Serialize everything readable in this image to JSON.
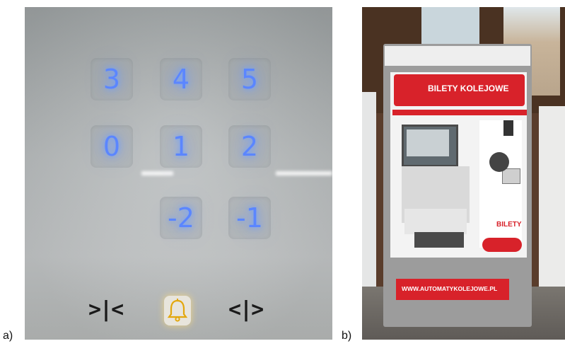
{
  "panels": {
    "a": {
      "label": "a)",
      "keys": [
        "3",
        "4",
        "5",
        "0",
        "1",
        "2",
        "-2",
        "-1"
      ],
      "door_open_symbol": "<|>",
      "door_close_symbol": ">|<",
      "alarm_icon": "bell-icon",
      "key_glow_color": "#5b86ff"
    },
    "b": {
      "label": "b)",
      "machine_title": "BILETY KOLEJOWE",
      "machine_footer": "WWW.AUTOMATYKOLEJOWE.PL",
      "side_text": "BILETY",
      "accent_color": "#d8222a"
    }
  }
}
